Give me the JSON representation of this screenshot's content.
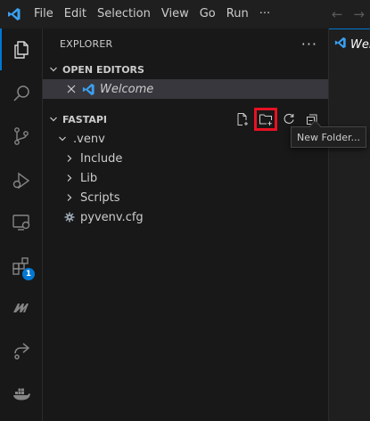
{
  "colors": {
    "accent": "#0078d4",
    "vscode_logo": "#3aa0f0",
    "highlight_box": "#e81123",
    "background": "#181818"
  },
  "menu": {
    "items": [
      "File",
      "Edit",
      "Selection",
      "View",
      "Go",
      "Run",
      "···"
    ]
  },
  "activity_bar": {
    "items": [
      {
        "icon": "files-icon",
        "active": true
      },
      {
        "icon": "search-icon"
      },
      {
        "icon": "source-control-icon"
      },
      {
        "icon": "run-debug-icon"
      },
      {
        "icon": "remote-explorer-icon"
      },
      {
        "icon": "extensions-icon",
        "badge": "1"
      },
      {
        "icon": "mm-extension-icon"
      },
      {
        "icon": "live-share-icon"
      },
      {
        "icon": "docker-icon"
      }
    ]
  },
  "explorer": {
    "title": "EXPLORER",
    "more": "···",
    "open_editors": {
      "title": "OPEN EDITORS",
      "items": [
        {
          "label": "Welcome"
        }
      ]
    },
    "folder": {
      "title": "FASTAPI",
      "tree": [
        {
          "label": ".venv",
          "expanded": true,
          "depth": 1
        },
        {
          "label": "Include",
          "expanded": false,
          "depth": 2
        },
        {
          "label": "Lib",
          "expanded": false,
          "depth": 2
        },
        {
          "label": "Scripts",
          "expanded": false,
          "depth": 2
        },
        {
          "label": "pyvenv.cfg",
          "file": true,
          "depth": 2
        }
      ]
    }
  },
  "tooltip": {
    "text": "New Folder..."
  },
  "editor": {
    "tab_label": "Welcome"
  }
}
